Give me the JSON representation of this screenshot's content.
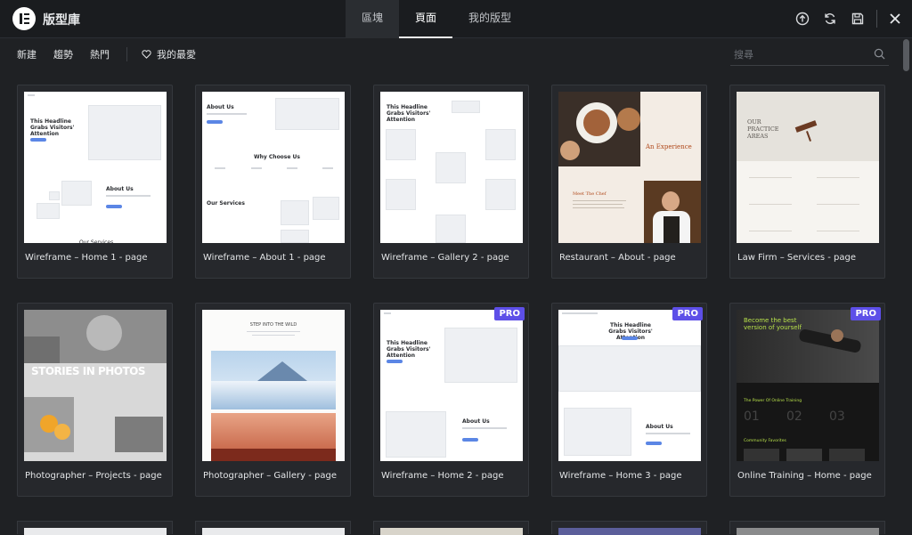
{
  "header": {
    "title": "版型庫",
    "tabs": [
      {
        "label": "區塊"
      },
      {
        "label": "頁面"
      },
      {
        "label": "我的版型"
      }
    ],
    "icons": [
      "upload-icon",
      "sync-icon",
      "save-icon",
      "close-icon"
    ]
  },
  "filters": {
    "items": [
      "新建",
      "趨勢",
      "熱門"
    ],
    "favorites": "我的最愛"
  },
  "search": {
    "placeholder": "搜尋"
  },
  "pro_label": "PRO",
  "thumb_text": {
    "wf_headline": "This Headline Grabs Visitors' Attention",
    "about_us": "About Us",
    "why_choose": "Why Choose Us",
    "our_services": "Our Services",
    "experience": "An Experience",
    "meet_chef": "Meet The Chef",
    "practice": "OUR PRACTICE AREAS",
    "stories": "STORIES IN PHOTOS",
    "step_wild": "STEP INTO THE WILD",
    "become": "Become the best version of yourself",
    "power": "The Power Of Online Training",
    "community": "Community Favorites"
  },
  "templates": [
    {
      "title": "Wireframe – Home 1 - page",
      "pro": false
    },
    {
      "title": "Wireframe – About 1 - page",
      "pro": false
    },
    {
      "title": "Wireframe – Gallery 2 - page",
      "pro": false
    },
    {
      "title": "Restaurant – About - page",
      "pro": false
    },
    {
      "title": "Law Firm – Services - page",
      "pro": false
    },
    {
      "title": "Photographer – Projects - page",
      "pro": false
    },
    {
      "title": "Photographer – Gallery - page",
      "pro": false
    },
    {
      "title": "Wireframe – Home 2 - page",
      "pro": true
    },
    {
      "title": "Wireframe – Home 3 - page",
      "pro": true
    },
    {
      "title": "Online Training – Home - page",
      "pro": true
    }
  ],
  "colors": {
    "background": "#1f2124",
    "topbar": "#1a1c1f",
    "card": "#26282c",
    "pro_badge": "#5d4fe8",
    "wireframe_button": "#5b86e5"
  }
}
